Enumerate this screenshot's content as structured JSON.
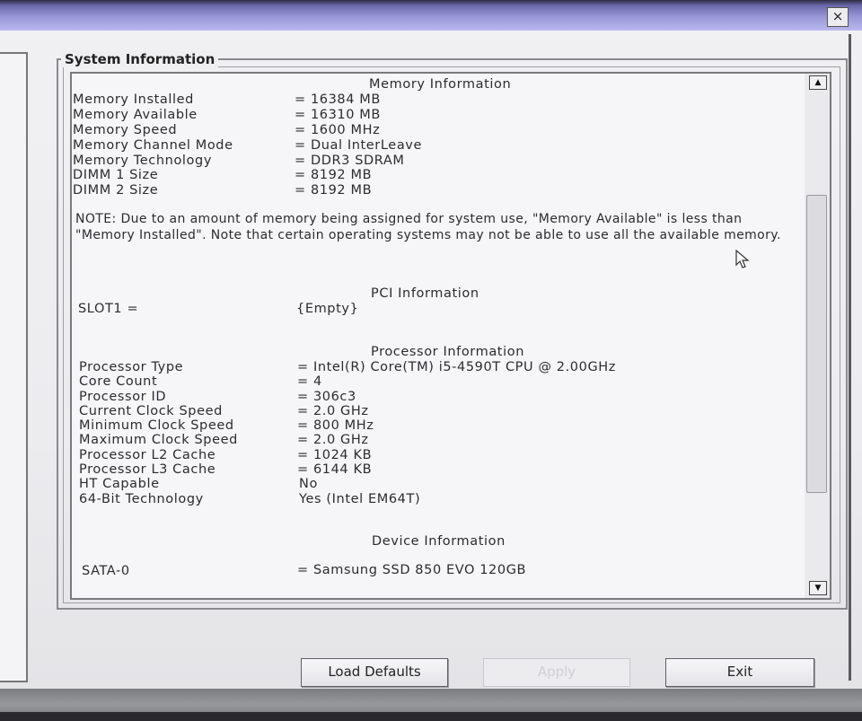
{
  "window": {
    "close_label": "×"
  },
  "group": {
    "title": "System Information"
  },
  "memory": {
    "header": "Memory Information",
    "rows": [
      {
        "label": "Memory Installed",
        "value": "= 16384 MB"
      },
      {
        "label": "Memory Available",
        "value": "= 16310 MB"
      },
      {
        "label": "Memory Speed",
        "value": "= 1600 MHz"
      },
      {
        "label": "Memory Channel Mode",
        "value": "= Dual InterLeave"
      },
      {
        "label": "Memory Technology",
        "value": "= DDR3 SDRAM"
      },
      {
        "label": "DIMM 1 Size",
        "value": "= 8192 MB"
      },
      {
        "label": "DIMM 2 Size",
        "value": "= 8192 MB"
      }
    ],
    "note": "NOTE: Due to an amount of memory being assigned for system use, \"Memory Available\" is less than \"Memory Installed\". Note that certain operating systems may not be able to use all the available memory."
  },
  "pci": {
    "header": "PCI Information",
    "rows": [
      {
        "label": "SLOT1 =",
        "value": "{Empty}"
      }
    ]
  },
  "processor": {
    "header": "Processor Information",
    "rows": [
      {
        "label": "Processor Type",
        "value": "= Intel(R) Core(TM) i5-4590T CPU @ 2.00GHz"
      },
      {
        "label": "Core Count",
        "value": "= 4"
      },
      {
        "label": "Processor ID",
        "value": "= 306c3"
      },
      {
        "label": "Current Clock Speed",
        "value": "= 2.0 GHz"
      },
      {
        "label": "Minimum Clock Speed",
        "value": "= 800 MHz"
      },
      {
        "label": "Maximum Clock Speed",
        "value": "= 2.0 GHz"
      },
      {
        "label": "Processor L2 Cache",
        "value": "= 1024 KB"
      },
      {
        "label": "Processor L3 Cache",
        "value": "= 6144 KB"
      },
      {
        "label": "HT Capable",
        "value": "No"
      },
      {
        "label": "64-Bit Technology",
        "value": "Yes (Intel EM64T)"
      }
    ]
  },
  "device": {
    "header": "Device Information",
    "rows": [
      {
        "label": "SATA-0",
        "value": "= Samsung SSD 850 EVO 120GB"
      }
    ]
  },
  "scrollbar": {
    "up_icon": "▲",
    "down_icon": "▼"
  },
  "buttons": {
    "load_defaults": "Load Defaults",
    "apply": "Apply",
    "exit": "Exit"
  },
  "colors": {
    "titlebar": "#9a97d6",
    "background": "#efeff2"
  },
  "icons": {
    "cursor": "mouse-pointer-icon",
    "close": "close-icon"
  }
}
